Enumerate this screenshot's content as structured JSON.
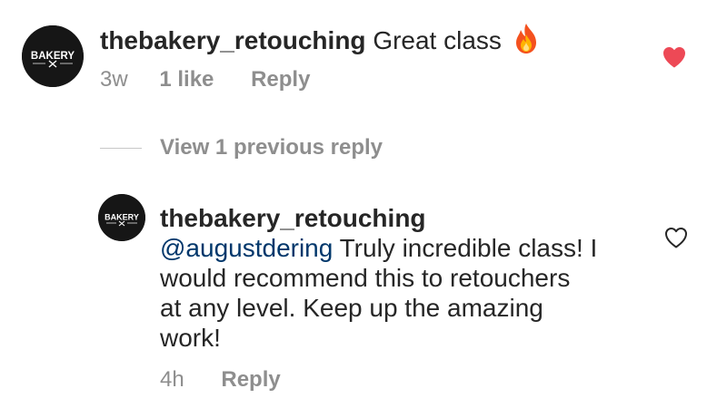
{
  "comments": [
    {
      "avatar": {
        "icon": "bakery-logo-avatar",
        "logo_text": "BAKERY",
        "background": "#161616"
      },
      "username": "thebakery_retouching",
      "text": "Great class",
      "emoji": "fire-icon",
      "time": "3w",
      "likes_label": "1 like",
      "reply_label": "Reply",
      "liked": true,
      "like_color": "#ed4956"
    },
    {
      "avatar": {
        "icon": "bakery-logo-avatar",
        "logo_text": "BAKERY",
        "background": "#161616"
      },
      "username": "thebakery_retouching",
      "mention": "@augustdering",
      "text_lines": [
        " Truly incredible class! I",
        "would recommend this to retouchers",
        "at any level. Keep up the amazing",
        "work!"
      ],
      "time": "4h",
      "reply_label": "Reply",
      "liked": false
    }
  ],
  "replies_toggle": {
    "label": "View 1 previous reply"
  },
  "colors": {
    "text": "#262626",
    "secondary": "#8e8e8e",
    "mention": "#00376b",
    "like": "#ed4956"
  }
}
